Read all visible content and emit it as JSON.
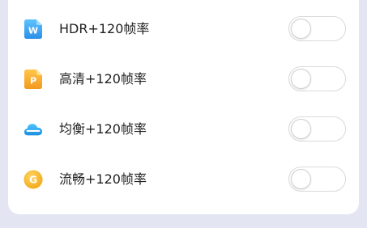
{
  "settings": {
    "items": [
      {
        "label": "HDR+120帧率",
        "icon": "app-w-icon",
        "icon_letter": "W",
        "icon_color": "#3aa0f0",
        "enabled": false
      },
      {
        "label": "高清+120帧率",
        "icon": "app-p-icon",
        "icon_letter": "P",
        "icon_color": "#f5a623",
        "enabled": false
      },
      {
        "label": "均衡+120帧率",
        "icon": "cloud-icon",
        "icon_letter": "",
        "icon_color": "#2aa7e8",
        "enabled": false
      },
      {
        "label": "流畅+120帧率",
        "icon": "app-g-icon",
        "icon_letter": "G",
        "icon_color": "#f7b81b",
        "enabled": false
      }
    ]
  }
}
